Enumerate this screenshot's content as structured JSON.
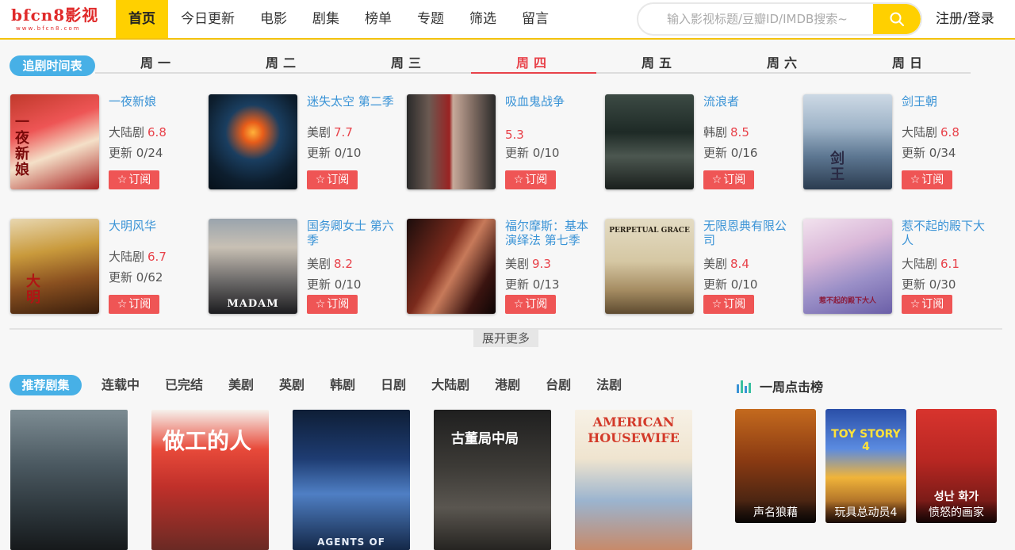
{
  "brand": {
    "logo_text": "bfcn8影视",
    "logo_sub": "www.bfcn8.com"
  },
  "nav": [
    "首页",
    "今日更新",
    "电影",
    "剧集",
    "榜单",
    "专题",
    "筛选",
    "留言"
  ],
  "search": {
    "placeholder": "输入影视标题/豆瓣ID/IMDB搜索~"
  },
  "login": "注册/登录",
  "schedule": {
    "label": "追剧时间表",
    "days": [
      "周一",
      "周二",
      "周三",
      "周四",
      "周五",
      "周六",
      "周日"
    ],
    "active_day": "周四",
    "subscribe_label": "订阅",
    "shows": [
      {
        "title": "一夜新娘",
        "region": "大陆剧",
        "rating": "6.8",
        "update": "更新 0/24"
      },
      {
        "title": "迷失太空 第二季",
        "region": "美剧",
        "rating": "7.7",
        "update": "更新 0/10"
      },
      {
        "title": "吸血鬼战争",
        "region": "",
        "rating": "5.3",
        "update": "更新 0/10"
      },
      {
        "title": "流浪者",
        "region": "韩剧",
        "rating": "8.5",
        "update": "更新 0/16"
      },
      {
        "title": "剑王朝",
        "region": "大陆剧",
        "rating": "6.8",
        "update": "更新 0/34"
      },
      {
        "title": "大明风华",
        "region": "大陆剧",
        "rating": "6.7",
        "update": "更新 0/62"
      },
      {
        "title": "国务卿女士 第六季",
        "region": "美剧",
        "rating": "8.2",
        "update": "更新 0/10"
      },
      {
        "title": "福尔摩斯：基本演绎法 第七季",
        "region": "美剧",
        "rating": "9.3",
        "update": "更新 0/13"
      },
      {
        "title": "无限恩典有限公司",
        "region": "美剧",
        "rating": "8.4",
        "update": "更新 0/10"
      },
      {
        "title": "惹不起的殿下大人",
        "region": "大陆剧",
        "rating": "6.1",
        "update": "更新 0/30"
      }
    ],
    "poster_texts": [
      "一夜新娘",
      "",
      "",
      "",
      "剑王",
      "大明",
      "MADAM",
      "",
      "PERPETUAL GRACE",
      "惹不起的殿下大人"
    ]
  },
  "more_label": "展开更多",
  "recommend": {
    "label": "推荐剧集",
    "tabs": [
      "连载中",
      "已完结",
      "美剧",
      "英剧",
      "韩剧",
      "日剧",
      "大陆剧",
      "港剧",
      "台剧",
      "法剧"
    ],
    "poster_texts": [
      "",
      "做工的人",
      "AGENTS OF",
      "古董局中局",
      "AMERICAN HOUSEWIFE"
    ]
  },
  "ranking": {
    "title": "一周点击榜",
    "items": [
      "声名狼藉",
      "玩具总动员4",
      "愤怒的画家"
    ],
    "poster_texts": [
      "",
      "TOY STORY 4",
      "성난 화가"
    ]
  },
  "colors": {
    "accent": "#ffd000",
    "blue": "#47b0e6",
    "red": "#e8424a",
    "link": "#3a93d6"
  }
}
